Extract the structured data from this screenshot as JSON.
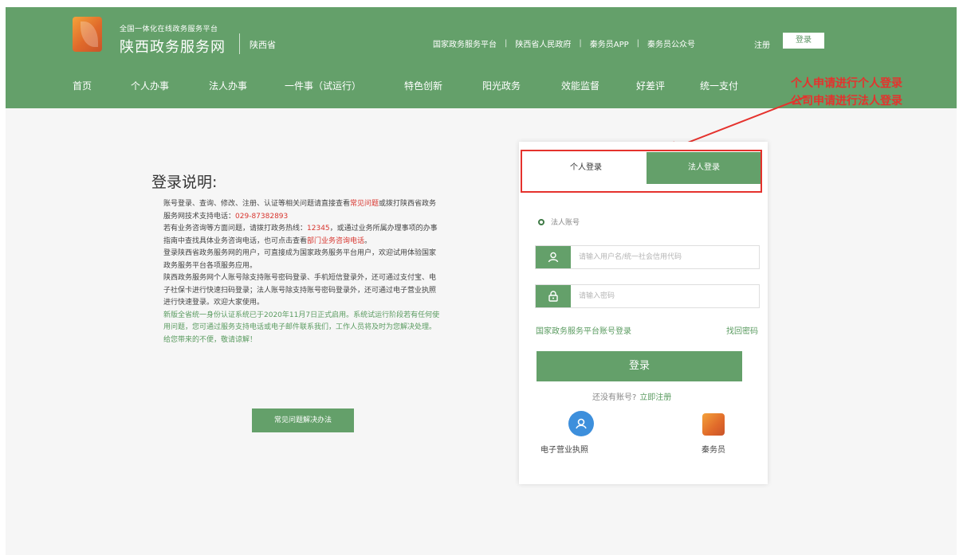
{
  "header": {
    "platform_subtitle": "全国一体化在线政务服务平台",
    "site_title": "陕西政务服务网",
    "region": "陕西省",
    "top_links": [
      "国家政务服务平台",
      "陕西省人民政府",
      "秦务员APP",
      "秦务员公众号"
    ],
    "register": "注册",
    "login": "登录"
  },
  "nav": {
    "items": [
      "首页",
      "个人办事",
      "法人办事",
      "一件事（试运行）",
      "特色创新",
      "阳光政务",
      "效能监督",
      "好差评",
      "统一支付"
    ]
  },
  "annotation": {
    "line1": "个人申请进行个人登录",
    "line2": "公司申请进行法人登录"
  },
  "instructions": {
    "title": "登录说明:",
    "p1_a": "账号登录、查询、修改、注册、认证等相关问题请直接查看",
    "p1_link": "常见问题",
    "p1_b": "或拨打陕西省政务服务网技术支持电话：",
    "p1_phone": "029-87382893",
    "p2_a": "若有业务咨询等方面问题，请拨打政务热线：",
    "p2_hotline": "12345",
    "p2_b": "，或通过业务所属办理事项的办事指南中查找具体业务咨询电话，也可点击查看",
    "p2_link": "部门业务咨询电话",
    "p2_end": "。",
    "p3": "登录陕西省政务服务网的用户，可直接成为国家政务服务平台用户，欢迎试用体验国家政务服务平台各项服务应用。",
    "p4": "陕西政务服务网个人账号除支持账号密码登录、手机短信登录外，还可通过支付宝、电子社保卡进行快速扫码登录；法人账号除支持账号密码登录外，还可通过电子营业执照进行快速登录。欢迎大家使用。",
    "p5": "新版全省统一身份认证系统已于2020年11月7日正式启用。系统试运行阶段若有任何使用问题，您可通过服务支持电话或电子邮件联系我们，工作人员将及时为您解决处理。给您带来的不便，敬请谅解！",
    "faq_button": "常见问题解决办法"
  },
  "login_card": {
    "tab_personal": "个人登录",
    "tab_legal": "法人登录",
    "account_type": "法人账号",
    "username_placeholder": "请输入用户名/统一社会信用代码",
    "password_placeholder": "请输入密码",
    "national_login": "国家政务服务平台账号登录",
    "forgot_password": "找回密码",
    "login_button": "登录",
    "no_account": "还没有账号?",
    "register_now": "立即注册",
    "ebiz_license": "电子营业执照",
    "qinwuyuan": "秦务员"
  },
  "colors": {
    "header_green": "#64a06a",
    "annotation_red": "#e5322d",
    "link_green": "#5a9b60"
  },
  "icons": [
    "logo-icon",
    "user-icon",
    "lock-icon",
    "qr-code-icon",
    "ebiz-license-icon",
    "qinwuyuan-icon"
  ]
}
